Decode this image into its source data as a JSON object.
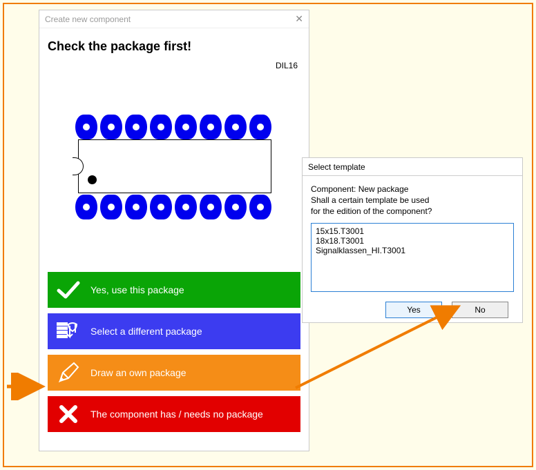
{
  "main_window": {
    "title": "Create new component",
    "heading": "Check the package first!",
    "package_name": "DIL16",
    "options": {
      "use": "Yes, use this package",
      "select": "Select a different package",
      "draw": "Draw an own package",
      "none": "The component has / needs no package"
    }
  },
  "dialog": {
    "title": "Select template",
    "line1": "Component: New package",
    "line2": "Shall a certain template be used",
    "line3": "for the edition of the component?",
    "templates": [
      "15x15.T3001",
      "18x18.T3001",
      "Signalklassen_HI.T3001"
    ],
    "yes": "Yes",
    "no": "No"
  }
}
